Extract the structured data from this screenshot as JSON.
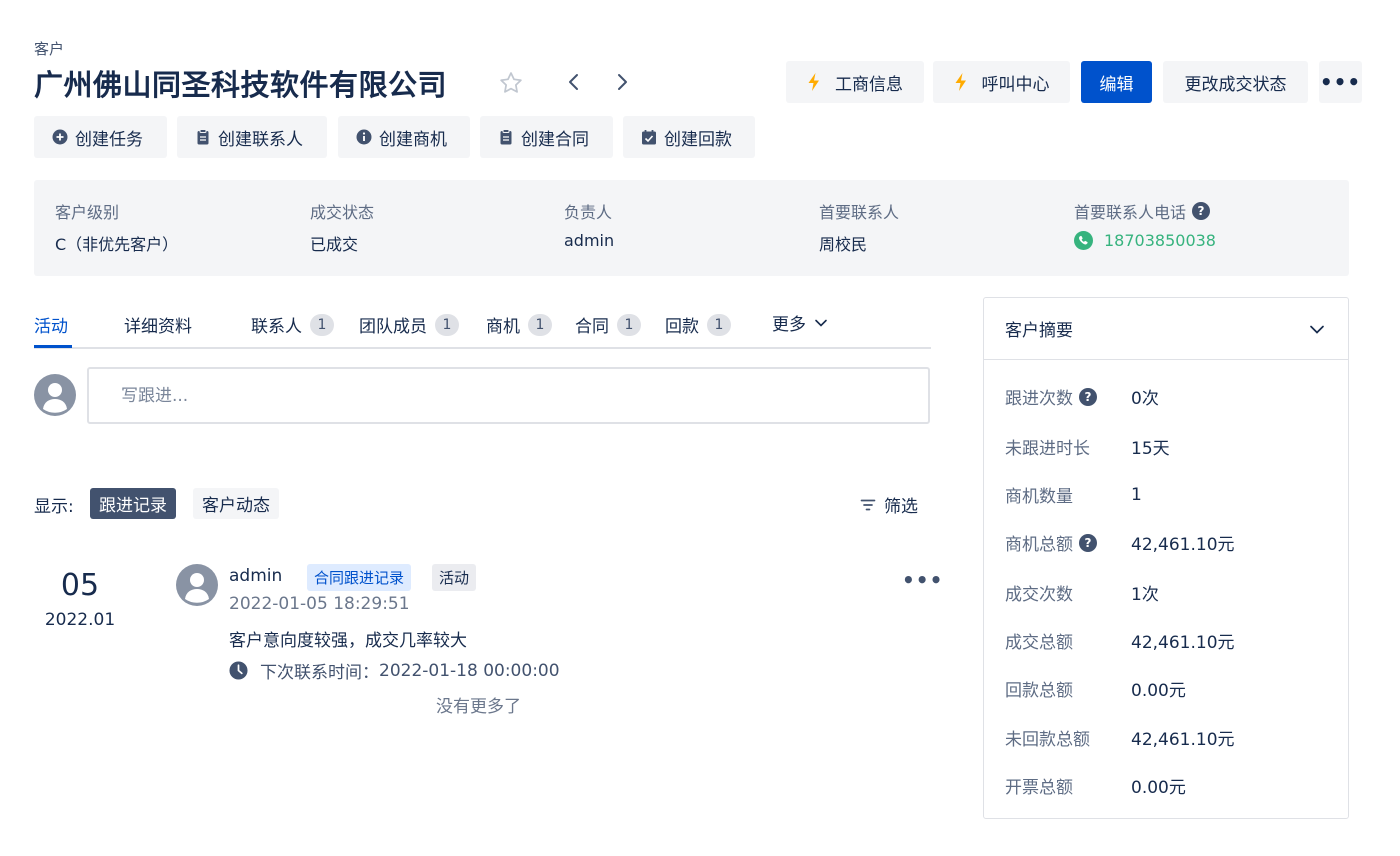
{
  "header": {
    "breadcrumb": "客户",
    "title": "广州佛山同圣科技软件有限公司",
    "buttons": {
      "business_info": "工商信息",
      "call_center": "呼叫中心",
      "edit": "编辑",
      "change_status": "更改成交状态",
      "more": "•••"
    }
  },
  "actions": {
    "create_task": "创建任务",
    "create_contact": "创建联系人",
    "create_opportunity": "创建商机",
    "create_contract": "创建合同",
    "create_payment": "创建回款"
  },
  "info": {
    "level_label": "客户级别",
    "level_value": "C（非优先客户）",
    "status_label": "成交状态",
    "status_value": "已成交",
    "owner_label": "负责人",
    "owner_value": "admin",
    "contact_label": "首要联系人",
    "contact_value": "周校民",
    "phone_label": "首要联系人电话",
    "phone_value": "18703850038"
  },
  "tabs": [
    {
      "label": "活动"
    },
    {
      "label": "详细资料"
    },
    {
      "label": "联系人",
      "count": "1"
    },
    {
      "label": "团队成员",
      "count": "1"
    },
    {
      "label": "商机",
      "count": "1"
    },
    {
      "label": "合同",
      "count": "1"
    },
    {
      "label": "回款",
      "count": "1"
    },
    {
      "label": "更多"
    }
  ],
  "composer": {
    "placeholder": "写跟进..."
  },
  "display": {
    "label": "显示:",
    "options": [
      "跟进记录",
      "客户动态"
    ],
    "selected": "跟进记录",
    "filter": "筛选"
  },
  "entry": {
    "day": "05",
    "month": "2022.01",
    "author": "admin",
    "tags": [
      "合同跟进记录",
      "活动"
    ],
    "timestamp": "2022-01-05 18:29:51",
    "content": "客户意向度较强，成交几率较大",
    "next_contact_label": "下次联系时间：",
    "next_contact_value": "2022-01-18 00:00:00",
    "more": "•••"
  },
  "no_more": "没有更多了",
  "summary": {
    "title": "客户摘要",
    "rows": [
      {
        "label": "跟进次数",
        "value": "0次",
        "help": true
      },
      {
        "label": "未跟进时长",
        "value": "15天"
      },
      {
        "label": "商机数量",
        "value": "1"
      },
      {
        "label": "商机总额",
        "value": "42,461.10元",
        "help": true
      },
      {
        "label": "成交次数",
        "value": "1次"
      },
      {
        "label": "成交总额",
        "value": "42,461.10元"
      },
      {
        "label": "回款总额",
        "value": "0.00元"
      },
      {
        "label": "未回款总额",
        "value": "42,461.10元"
      },
      {
        "label": "开票总额",
        "value": "0.00元"
      }
    ]
  },
  "colors": {
    "primary": "#0052cc",
    "phone": "#36b37e",
    "bolt": "#ffab00",
    "panel": "#f4f5f7"
  },
  "icons": {
    "favorite": "star-outline-icon",
    "prev": "chevron-left-icon",
    "next": "chevron-right-icon",
    "bolt": "lightning-bolt-icon",
    "phone": "phone-icon",
    "help": "question-circle-icon",
    "clock": "clock-icon",
    "filter": "filter-icon",
    "collapse": "chevron-down-icon"
  }
}
